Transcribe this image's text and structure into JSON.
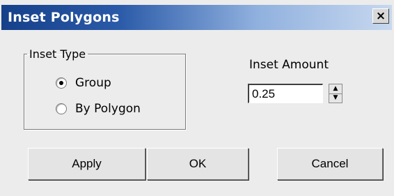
{
  "window": {
    "title": "Inset Polygons",
    "close_glyph": "×",
    "close_icon": "close-icon"
  },
  "inset_type": {
    "legend": "Inset Type",
    "options": [
      {
        "label": "Group",
        "checked": true
      },
      {
        "label": "By Polygon",
        "checked": false
      }
    ]
  },
  "inset_amount": {
    "label": "Inset Amount",
    "value": "0.25",
    "spinner_up_glyph": "▲",
    "spinner_down_glyph": "▼"
  },
  "buttons": {
    "apply": "Apply",
    "ok": "OK",
    "cancel": "Cancel"
  },
  "colors": {
    "titlebar_start": "#16408a",
    "titlebar_end": "#c7d8ef",
    "dialog_bg": "#ececec"
  }
}
